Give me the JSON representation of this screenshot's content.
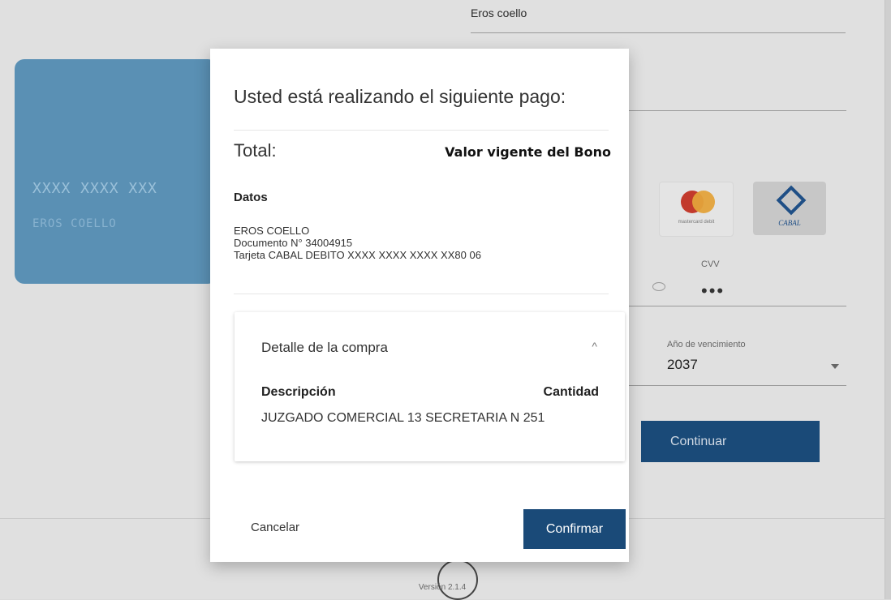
{
  "background": {
    "name_value": "Eros coello",
    "card": {
      "number": "XXXX XXXX XXX",
      "holder": "EROS COELLO"
    },
    "brands": {
      "mastercard_label": "mastercard debit",
      "cabal_label": "CABAL"
    },
    "cvv": {
      "label": "CVV",
      "value": "•••"
    },
    "expiry_year": {
      "label": "Año de vencimiento",
      "value": "2037"
    },
    "continue_label": "Continuar",
    "version": "Versión 2.1.4"
  },
  "modal": {
    "title": "Usted está realizando el siguiente pago:",
    "total_label": "Total:",
    "total_value": "Valor vigente del Bono",
    "datos_label": "Datos",
    "datos_lines": [
      "EROS COELLO",
      "Documento N° 34004915",
      "Tarjeta CABAL DEBITO    XXXX XXXX XXXX XX80 06"
    ],
    "detail": {
      "title": "Detalle de la compra",
      "col_description": "Descripción",
      "col_quantity": "Cantidad",
      "rows": [
        {
          "description": "JUZGADO COMERCIAL 13 SECRETARIA N 251",
          "quantity": ""
        }
      ]
    },
    "cancel_label": "Cancelar",
    "confirm_label": "Confirmar"
  },
  "colors": {
    "primary": "#1a4a78",
    "card_blue": "#5a90b4",
    "overlay_gray": "#e0e0e0"
  }
}
